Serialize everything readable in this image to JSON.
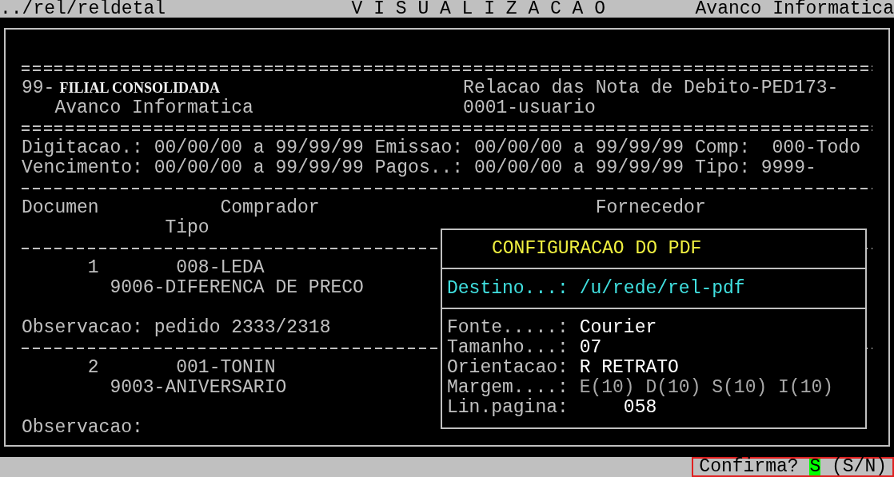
{
  "top_bar": {
    "path": "../rel/reldetal",
    "title": "V I S U A L I Z A C A O",
    "company": "Avanco Informatica"
  },
  "report": {
    "header": {
      "branch_code": "99-",
      "branch_name": "FILIAL CONSOLIDADA",
      "company": "Avanco Informatica",
      "report_title": "Relacao das Nota de Debito-PED173-",
      "user": "0001-usuario"
    },
    "filters": [
      [
        "Digitacao.: 00/00/00 a 99/99/99",
        "Emissao: 00/00/00 a 99/99/99",
        "Comp:  000-Todo"
      ],
      [
        "Vencimento: 00/00/00 a 99/99/99",
        "Pagos..: 00/00/00 a 99/99/99",
        "Tipo: 9999-"
      ]
    ],
    "columns": {
      "document": "Documen",
      "buyer": "Comprador",
      "supplier": "Fornecedor",
      "type": "Tipo"
    },
    "records": [
      {
        "document": "1",
        "buyer": "008-LEDA",
        "type": "9006-DIFERENCA DE PRECO",
        "note": "Observacao: pedido 2333/2318"
      },
      {
        "document": "2",
        "buyer": "001-TONIN",
        "type": "9003-ANIVERSARIO",
        "note": "Observacao:"
      }
    ]
  },
  "pdf_dialog": {
    "title": "CONFIGURACAO DO PDF",
    "destination": {
      "label": "Destino...:",
      "value": "/u/rede/rel-pdf"
    },
    "fields": [
      {
        "kind": "text",
        "label": "Fonte.....:",
        "value": "Courier"
      },
      {
        "kind": "text",
        "label": "Tamanho...:",
        "value": "07"
      },
      {
        "kind": "text",
        "label": "Orientacao:",
        "value": "R RETRATO"
      },
      {
        "kind": "margins",
        "label": "Margem....:",
        "value": "E(10) D(10) S(10) I(10)"
      },
      {
        "kind": "count",
        "label": "Lin.pagina:",
        "value": "058"
      }
    ]
  },
  "prompt": {
    "question": "Confirma?",
    "answer": "S",
    "options": "(S/N)"
  }
}
